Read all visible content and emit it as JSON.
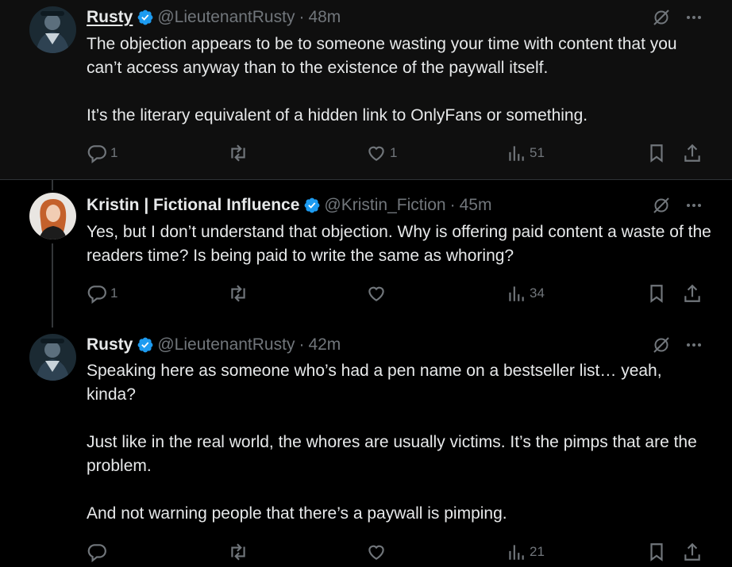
{
  "tweets": [
    {
      "name": "Rusty",
      "handle": "@LieutenantRusty",
      "time": "48m",
      "body": [
        "The objection appears to be to someone wasting your time with content that you can’t access anyway than to the existence of the paywall itself.",
        "It’s the literary equivalent of a hidden link to OnlyFans or something."
      ],
      "replies": "1",
      "retweets": "",
      "likes": "1",
      "views": "51"
    },
    {
      "name": "Kristin | Fictional Influence",
      "handle": "@Kristin_Fiction",
      "time": "45m",
      "body": [
        "Yes, but I don’t understand that objection. Why is offering paid content a waste of the readers time? Is being paid to write the same as whoring?"
      ],
      "replies": "1",
      "retweets": "",
      "likes": "",
      "views": "34"
    },
    {
      "name": "Rusty",
      "handle": "@LieutenantRusty",
      "time": "42m",
      "body": [
        "Speaking here as someone who’s had a pen name on a bestseller list… yeah, kinda?",
        "Just like in the real world, the whores are usually victims. It’s the pimps that are the problem.",
        "And not warning people that there’s a paywall is pimping."
      ],
      "replies": "",
      "retweets": "",
      "likes": "",
      "views": "21"
    }
  ],
  "icons": {
    "verified": "verified-badge-icon",
    "grok": "grok-icon",
    "more": "more-icon",
    "reply": "reply-icon",
    "retweet": "retweet-icon",
    "like": "like-icon",
    "views": "views-icon",
    "bookmark": "bookmark-icon",
    "share": "share-icon"
  },
  "colors": {
    "verified": "#1d9bf0",
    "muted": "#71767b",
    "text": "#e7e9ea",
    "background": "#000000"
  }
}
